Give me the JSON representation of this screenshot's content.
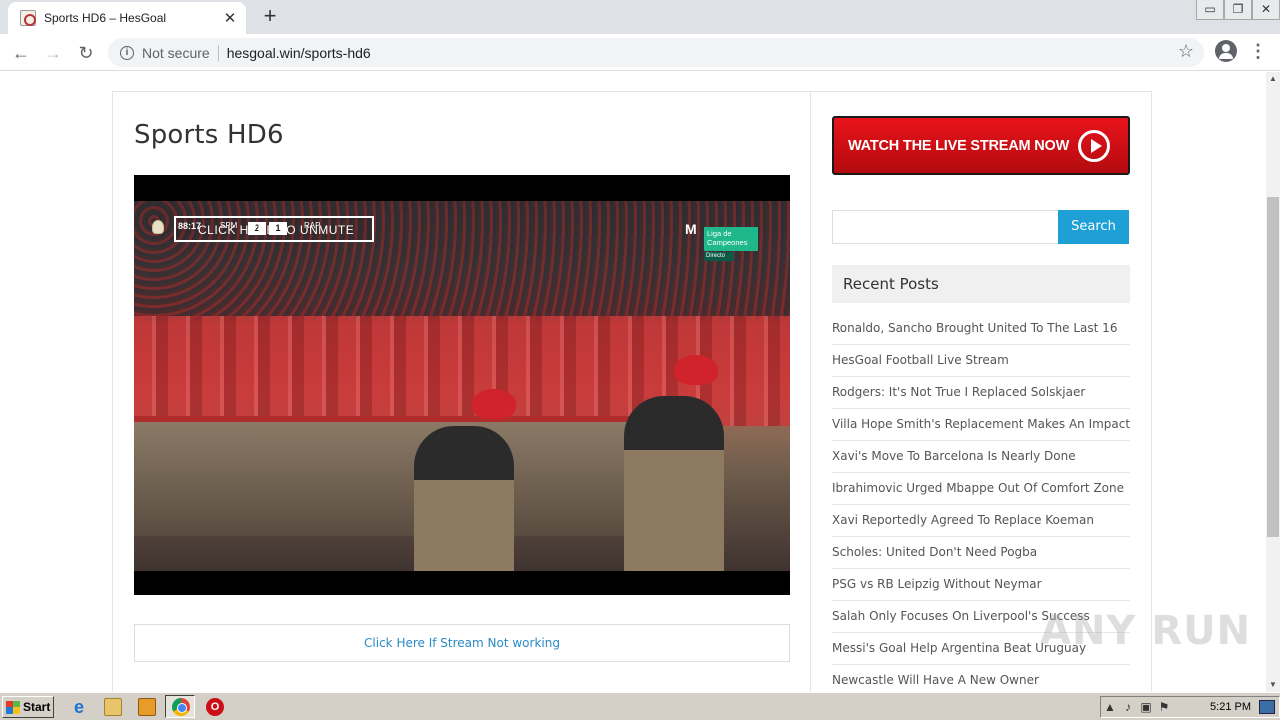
{
  "browser": {
    "tab_title": "Sports HD6 – HesGoal",
    "tab_close": "✕",
    "new_tab": "+",
    "win_controls": [
      "▭",
      "❐",
      "✕"
    ],
    "nav": {
      "back": "←",
      "forward": "→",
      "reload": "↻"
    },
    "security_label": "Not secure",
    "url": "hesgoal.win/sports-hd6",
    "star": "☆",
    "menu": "⋮"
  },
  "page": {
    "title": "Sports HD6",
    "video": {
      "clock": "88:17",
      "overlay_text": "CLICK HERE TO UNMUTE",
      "team_left": "SPM",
      "team_right": "RAP",
      "score": [
        "2",
        "1"
      ],
      "broadcaster": "M",
      "liga_badge": "Liga de Campeones",
      "live_label": "Directo"
    },
    "stream_link": "Click Here If Stream Not working"
  },
  "sidebar": {
    "banner_text": "WATCH THE LIVE STREAM NOW",
    "search_placeholder": "",
    "search_button": "Search",
    "recent_title": "Recent Posts",
    "recent_posts": [
      "Ronaldo, Sancho Brought United To The Last 16",
      "HesGoal Football Live Stream",
      "Rodgers: It's Not True I Replaced Solskjaer",
      "Villa Hope Smith's Replacement Makes An Impact",
      "Xavi's Move To Barcelona Is Nearly Done",
      "Ibrahimovic Urged Mbappe Out Of Comfort Zone",
      "Xavi Reportedly Agreed To Replace Koeman",
      "Scholes: United Don't Need Pogba",
      "PSG vs RB Leipzig Without Neymar",
      "Salah Only Focuses On Liverpool's Success",
      "Messi's Goal Help Argentina Beat Uruguay",
      "Newcastle Will Have A New Owner"
    ]
  },
  "watermark": "ANY RUN",
  "taskbar": {
    "start_label": "Start",
    "clock": "5:21 PM"
  }
}
